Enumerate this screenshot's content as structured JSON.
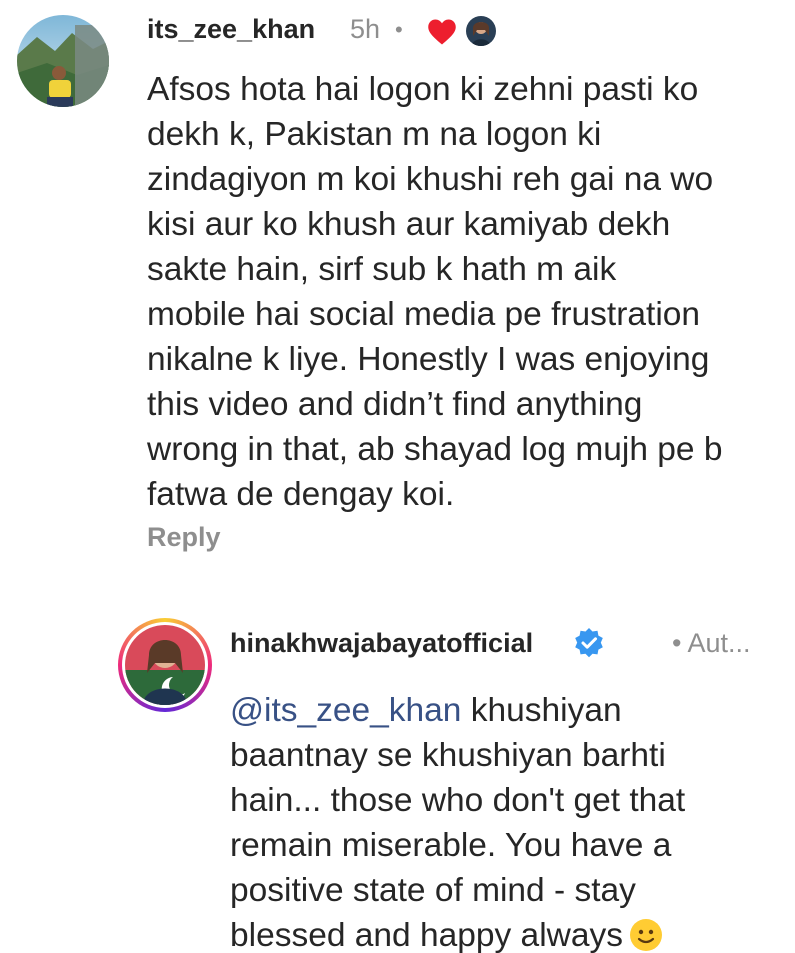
{
  "comments": [
    {
      "username": "its_zee_khan",
      "time": "5h",
      "separator": "•",
      "avatar_icon": "user-avatar-icon",
      "liked_by_icon": "heart-icon",
      "lines": [
        "Afsos hota hai logon ki zehni pasti ko",
        "dekh k, Pakistan m na logon ki",
        "zindagiyon m koi khushi reh gai na wo",
        "kisi aur ko khush aur kamiyab dekh",
        "sakte hain, sirf sub k hath m aik",
        "mobile hai social media pe frustration",
        "nikalne k liye. Honestly I was enjoying",
        "this video and didn’t find anything",
        "wrong in that, ab shayad log mujh pe b",
        "fatwa de dengay koi."
      ],
      "reply_label": "Reply"
    },
    {
      "username": "hinakhwajabayatofficial",
      "verified_icon": "verified-badge-icon",
      "author_label": "• Aut...",
      "mention": "@its_zee_khan",
      "first_line_rest": " khushiyan",
      "lines": [
        "baantnay se khushiyan barhti",
        "hain... those who don't get that",
        "remain miserable. You have a",
        "positive state of mind - stay"
      ],
      "last_line": "blessed and happy always",
      "emoji_icon": "smiley-emoji-icon"
    }
  ],
  "colors": {
    "text": "#262626",
    "muted": "#8e8e8e",
    "mention": "#385185",
    "heart": "#ed1e2e",
    "verified": "#3897f0"
  }
}
